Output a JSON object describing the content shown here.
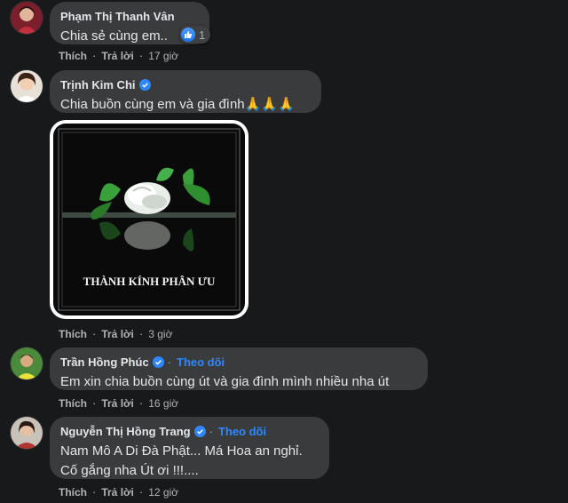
{
  "comments": [
    {
      "author": "Phạm Thị Thanh Vân",
      "text": "Chia sẻ cùng em..",
      "reaction_count": "1",
      "like_label": "Thích",
      "reply_label": "Trả lời",
      "time": "17 giờ",
      "verified": false
    },
    {
      "author": "Trịnh Kim Chi",
      "text": "Chia buồn cùng em và gia đình🙏🙏🙏",
      "like_label": "Thích",
      "reply_label": "Trả lời",
      "time": "3 giờ",
      "verified": true,
      "image": {
        "caption": "THÀNH KÍNH PHÂN ƯU"
      }
    },
    {
      "author": "Trần Hồng Phúc",
      "follow_label": "Theo dõi",
      "text": "Em xin chia buồn cùng út và gia đình mình nhiều nha út",
      "like_label": "Thích",
      "reply_label": "Trả lời",
      "time": "16 giờ",
      "verified": true
    },
    {
      "author": "Nguyễn Thị Hồng Trang",
      "follow_label": "Theo dõi",
      "text_line1": "Nam Mô A Di Đà Phật... Má Hoa an nghỉ.",
      "text_line2": "Cố gắng nha Út ơi !!!....",
      "like_label": "Thích",
      "reply_label": "Trả lời",
      "time": "12 giờ",
      "verified": true
    }
  ],
  "separator": "·",
  "colors": {
    "background": "#18191a",
    "bubble": "#3a3b3c",
    "link_blue": "#2d88ff",
    "secondary_text": "#b0b3b8"
  },
  "icons": [
    "verified-badge-icon",
    "like-reaction-icon"
  ]
}
